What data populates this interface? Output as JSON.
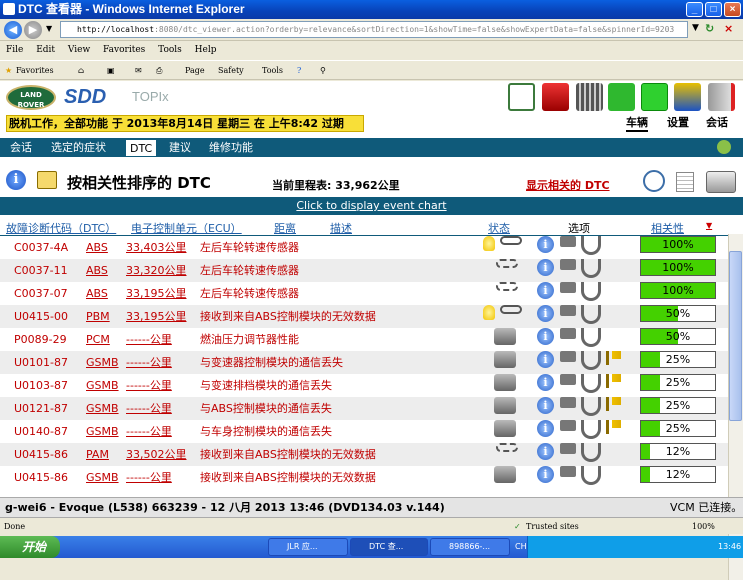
{
  "window": {
    "title": "DTC 查看器 - Windows Internet Explorer",
    "btn_min": "_",
    "btn_max": "□",
    "btn_close": "×"
  },
  "address": {
    "host": "http://localhost",
    "rest": ":8080/dtc_viewer.action?orderby=relevance&sortDirection=1&showTime=false&showExpertData=false&spinnerId=9203"
  },
  "menu": [
    "File",
    "Edit",
    "View",
    "Favorites",
    "Tools",
    "Help"
  ],
  "favbar": {
    "favorites": "Favorites",
    "page": "Page",
    "safety": "Safety",
    "tools": "Tools"
  },
  "app": {
    "logo_text": "LAND ROVER",
    "brand": "SDD",
    "product": "TOPIx",
    "warning": "脱机工作，全部功能 于 2013年8月14日 星期三 在 上午8:42 过期",
    "top_tabs": [
      "车辆",
      "设置",
      "会话"
    ],
    "tabs": [
      "会话",
      "选定的症状",
      "DTC",
      "建议",
      "维修功能"
    ],
    "heading": "按相关性排序的 DTC",
    "mileage": "当前里程表: 33,962公里",
    "show_related": "显示相关的 DTC",
    "event_chart": "Click to display event chart",
    "columns": {
      "code": "故障诊断代码（DTC）",
      "ecu": "电子控制单元（ECU）",
      "distance": "距离",
      "description": "描述",
      "status": "状态",
      "options": "选项",
      "relevance": "相关性"
    },
    "rows": [
      {
        "code": "C0037-4A",
        "ecu": "ABS",
        "distance": "33,403公里",
        "description": "左后车轮转速传感器",
        "relevance": 100,
        "label": "100%"
      },
      {
        "code": "C0037-11",
        "ecu": "ABS",
        "distance": "33,320公里",
        "description": "左后车轮转速传感器",
        "relevance": 100,
        "label": "100%"
      },
      {
        "code": "C0037-07",
        "ecu": "ABS",
        "distance": "33,195公里",
        "description": "左后车轮转速传感器",
        "relevance": 100,
        "label": "100%"
      },
      {
        "code": "U0415-00",
        "ecu": "PBM",
        "distance": "33,195公里",
        "description": "接收到来自ABS控制模块的无效数据",
        "relevance": 50,
        "label": "50%"
      },
      {
        "code": "P0089-29",
        "ecu": "PCM",
        "distance": "------公里",
        "description": "燃油压力调节器性能",
        "relevance": 50,
        "label": "50%"
      },
      {
        "code": "U0101-87",
        "ecu": "GSMB",
        "distance": "------公里",
        "description": "与变速器控制模块的通信丢失",
        "relevance": 25,
        "label": "25%"
      },
      {
        "code": "U0103-87",
        "ecu": "GSMB",
        "distance": "------公里",
        "description": "与变速排档模块的通信丢失",
        "relevance": 25,
        "label": "25%"
      },
      {
        "code": "U0121-87",
        "ecu": "GSMB",
        "distance": "------公里",
        "description": "与ABS控制模块的通信丢失",
        "relevance": 25,
        "label": "25%"
      },
      {
        "code": "U0140-87",
        "ecu": "GSMB",
        "distance": "------公里",
        "description": "与车身控制模块的通信丢失",
        "relevance": 25,
        "label": "25%"
      },
      {
        "code": "U0415-86",
        "ecu": "PAM",
        "distance": "33,502公里",
        "description": "接收到来自ABS控制模块的无效数据",
        "relevance": 12,
        "label": "12%"
      },
      {
        "code": "U0415-86",
        "ecu": "GSMB",
        "distance": "------公里",
        "description": "接收到来自ABS控制模块的无效数据",
        "relevance": 12,
        "label": "12%"
      }
    ],
    "row_icons": [
      {
        "status": "bulb+chain",
        "flag": false
      },
      {
        "status": "broken-chain",
        "flag": false
      },
      {
        "status": "broken-chain",
        "flag": false
      },
      {
        "status": "bulb+chain",
        "flag": false
      },
      {
        "status": "car",
        "flag": false
      },
      {
        "status": "car",
        "flag": true
      },
      {
        "status": "car",
        "flag": true
      },
      {
        "status": "car",
        "flag": true
      },
      {
        "status": "car",
        "flag": true
      },
      {
        "status": "broken-chain",
        "flag": false
      },
      {
        "status": "car",
        "flag": false
      }
    ],
    "status_left": "g-wei6 - Evoque (L538) 663239 - 12 八月 2013 13:46 (DVD134.03 v.144)",
    "status_right": "VCM 已连接。",
    "accent": "#0f5a7a",
    "bar_color": "#44d100"
  },
  "ie_status": {
    "done": "Done",
    "zone": "Trusted sites",
    "zoom": "100%"
  },
  "taskbar": {
    "start": "开始",
    "tasks": [
      "JLR 应...",
      "DTC 查...",
      "898866-..."
    ],
    "lang": "CH",
    "clock": "13:46"
  }
}
